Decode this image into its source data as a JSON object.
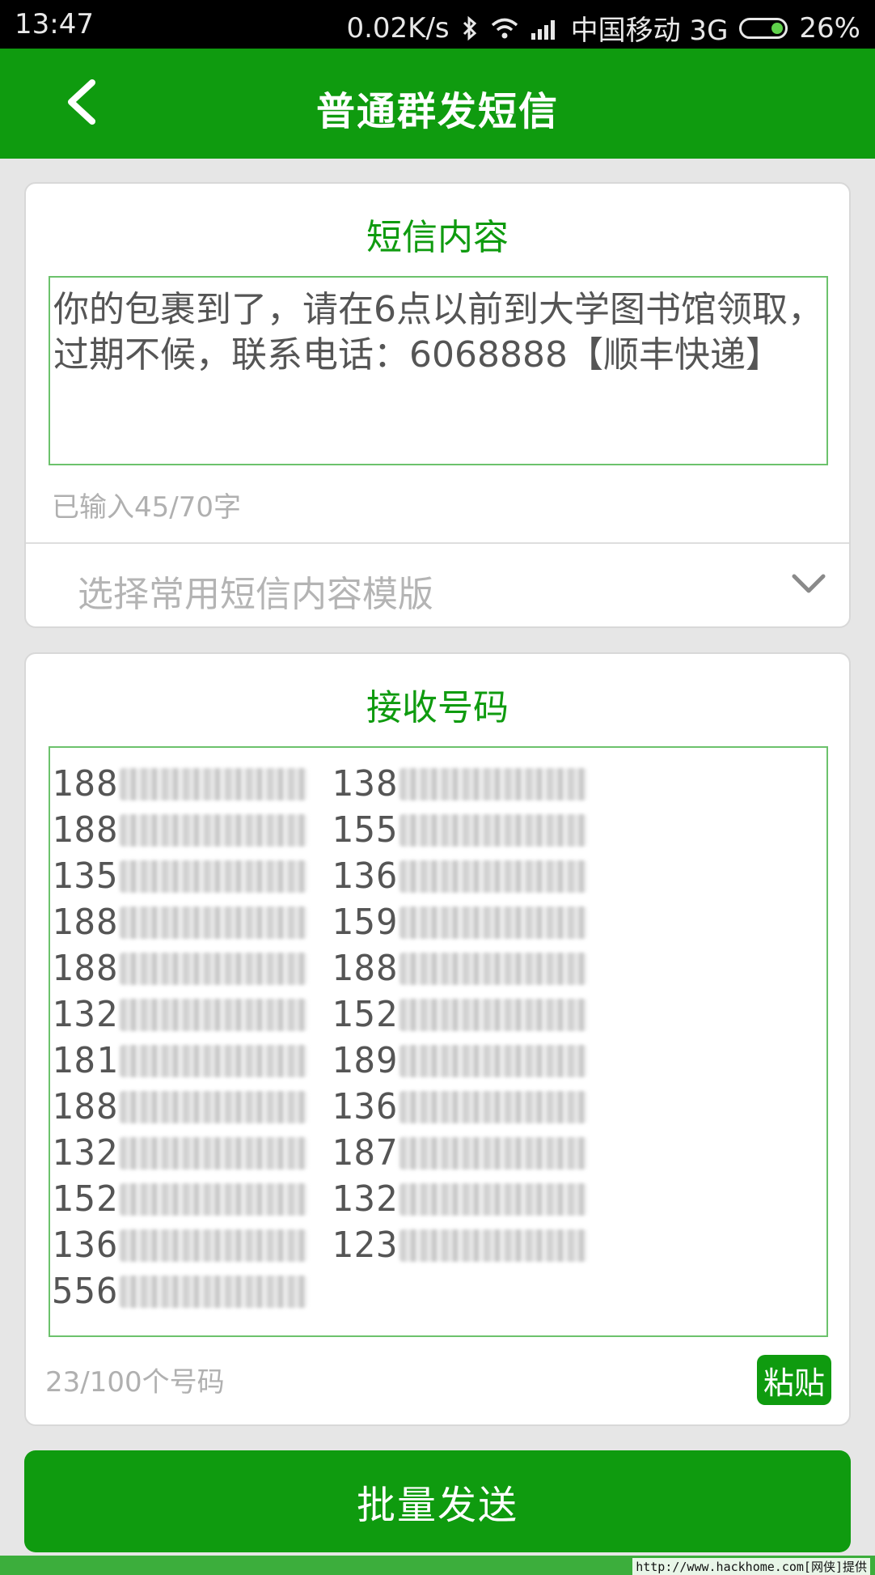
{
  "status_bar": {
    "time": "13:47",
    "net_speed": "0.02K/s",
    "carrier": "中国移动 3G",
    "battery": "26%",
    "battery_level": 0.26
  },
  "header": {
    "title": "普通群发短信"
  },
  "sms": {
    "section_title": "短信内容",
    "content": "你的包裹到了，请在6点以前到大学图书馆领取，过期不候，联系电话：6068888【顺丰快递】",
    "char_count": "已输入45/70字",
    "template_placeholder": "选择常用短信内容模版"
  },
  "recipients": {
    "section_title": "接收号码",
    "numbers": [
      "188",
      "138",
      "188",
      "155",
      "135",
      "136",
      "188",
      "159",
      "188",
      "188",
      "132",
      "152",
      "181",
      "189",
      "188",
      "136",
      "132",
      "187",
      "152",
      "132",
      "136",
      "123",
      "556"
    ],
    "count": "23/100个号码",
    "paste_label": "粘贴"
  },
  "actions": {
    "send_label": "批量发送"
  },
  "watermark": "http://www.hackhome.com[网侠]提供",
  "colors": {
    "brand_green": "#0f9b0f",
    "border_green": "#6cc26c"
  }
}
